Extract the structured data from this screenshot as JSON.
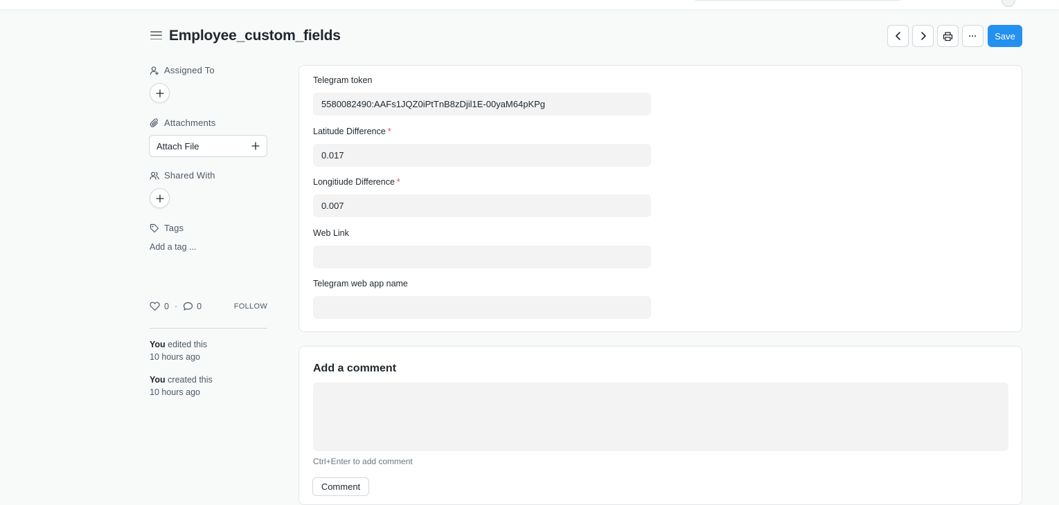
{
  "header": {
    "title": "Employee_custom_fields",
    "save_label": "Save",
    "more_label": "···"
  },
  "sidebar": {
    "assigned_to": "Assigned To",
    "attachments": "Attachments",
    "attach_file": "Attach File",
    "shared_with": "Shared With",
    "tags": "Tags",
    "add_tag": "Add a tag ...",
    "likes": "0",
    "comments": "0",
    "separator": "·",
    "follow": "FOLLOW",
    "activity": [
      {
        "who": "You",
        "action": "edited this",
        "when": "10 hours ago"
      },
      {
        "who": "You",
        "action": "created this",
        "when": "10 hours ago"
      }
    ]
  },
  "form": {
    "fields": [
      {
        "label": "Telegram token",
        "value": "5580082490:AAFs1JQZ0iPtTnB8zDjil1E-00yaM64pKPg",
        "required": false
      },
      {
        "label": "Latitude Difference",
        "value": "0.017",
        "required": true
      },
      {
        "label": "Longitiude Difference",
        "value": "0.007",
        "required": true
      },
      {
        "label": "Web Link",
        "value": "",
        "required": false
      },
      {
        "label": "Telegram web app name",
        "value": "",
        "required": false
      }
    ],
    "required_mark": "*"
  },
  "comment": {
    "title": "Add a comment",
    "hint": "Ctrl+Enter to add comment",
    "button": "Comment"
  },
  "colors": {
    "primary": "#2490ef",
    "required": "#e24c4c",
    "background": "#f8f9f9",
    "input_bg": "#f3f3f3"
  }
}
